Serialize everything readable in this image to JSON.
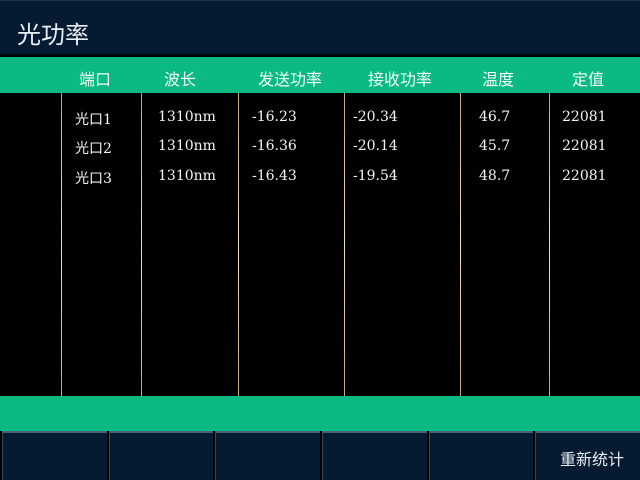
{
  "title": "光功率",
  "columns": [
    "端口",
    "波长",
    "发送功率",
    "接收功率",
    "温度",
    "定值"
  ],
  "rows": [
    [
      "光口1",
      "1310nm",
      "-16.23",
      "-20.34",
      "46.7",
      "22081"
    ],
    [
      "光口2",
      "1310nm",
      "-16.36",
      "-20.14",
      "45.7",
      "22081"
    ],
    [
      "光口3",
      "1310nm",
      "-16.43",
      "-19.54",
      "48.7",
      "22081"
    ]
  ],
  "buttons": [
    "",
    "",
    "",
    "",
    "",
    "重新统计"
  ],
  "colors": {
    "accent": "#0bb982",
    "titlebar": "#061b31"
  }
}
